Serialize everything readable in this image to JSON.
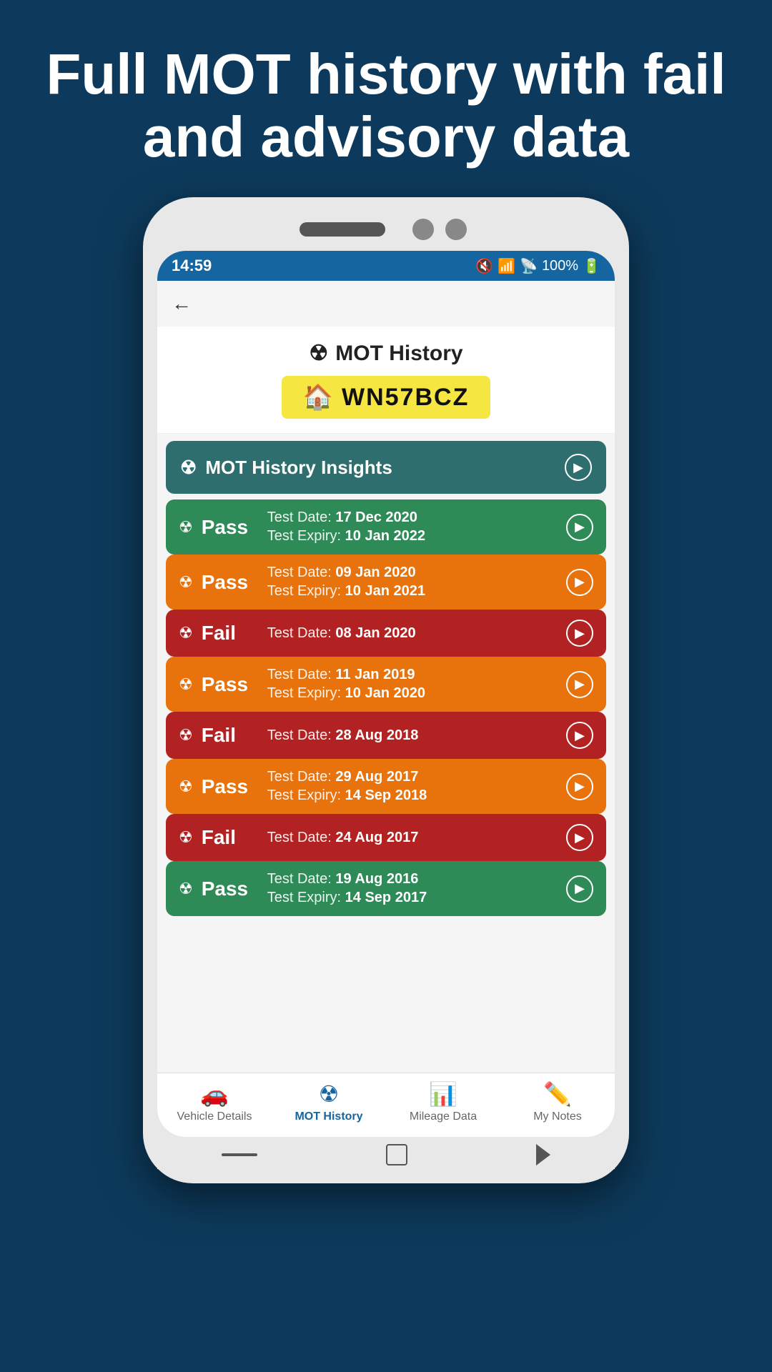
{
  "hero": {
    "text": "Full MOT history with fail and advisory data"
  },
  "status_bar": {
    "time": "14:59",
    "battery": "100%"
  },
  "page_title": "MOT History",
  "plate": "WN57BCZ",
  "insights_label": "MOT History Insights",
  "mot_records": [
    {
      "result": "Pass",
      "color": "pass-green",
      "test_date_label": "Test Date:",
      "test_date": "17 Dec 2020",
      "expiry_label": "Test Expiry:",
      "expiry": "10 Jan 2022"
    },
    {
      "result": "Pass",
      "color": "pass-orange",
      "test_date_label": "Test Date:",
      "test_date": "09 Jan 2020",
      "expiry_label": "Test Expiry:",
      "expiry": "10 Jan 2021"
    },
    {
      "result": "Fail",
      "color": "fail-red",
      "test_date_label": "Test Date:",
      "test_date": "08 Jan 2020",
      "expiry_label": null,
      "expiry": null
    },
    {
      "result": "Pass",
      "color": "pass-orange",
      "test_date_label": "Test Date:",
      "test_date": "11 Jan 2019",
      "expiry_label": "Test Expiry:",
      "expiry": "10 Jan 2020"
    },
    {
      "result": "Fail",
      "color": "fail-red",
      "test_date_label": "Test Date:",
      "test_date": "28 Aug 2018",
      "expiry_label": null,
      "expiry": null
    },
    {
      "result": "Pass",
      "color": "pass-orange",
      "test_date_label": "Test Date:",
      "test_date": "29 Aug 2017",
      "expiry_label": "Test Expiry:",
      "expiry": "14 Sep 2018"
    },
    {
      "result": "Fail",
      "color": "fail-red",
      "test_date_label": "Test Date:",
      "test_date": "24 Aug 2017",
      "expiry_label": null,
      "expiry": null
    },
    {
      "result": "Pass",
      "color": "pass-green",
      "test_date_label": "Test Date:",
      "test_date": "19 Aug 2016",
      "expiry_label": "Test Expiry:",
      "expiry": "14 Sep 2017"
    }
  ],
  "bottom_nav": [
    {
      "label": "Vehicle Details",
      "active": false,
      "icon": "car"
    },
    {
      "label": "MOT History",
      "active": true,
      "icon": "hazmat"
    },
    {
      "label": "Mileage Data",
      "active": false,
      "icon": "chart"
    },
    {
      "label": "My Notes",
      "active": false,
      "icon": "pencil"
    }
  ]
}
